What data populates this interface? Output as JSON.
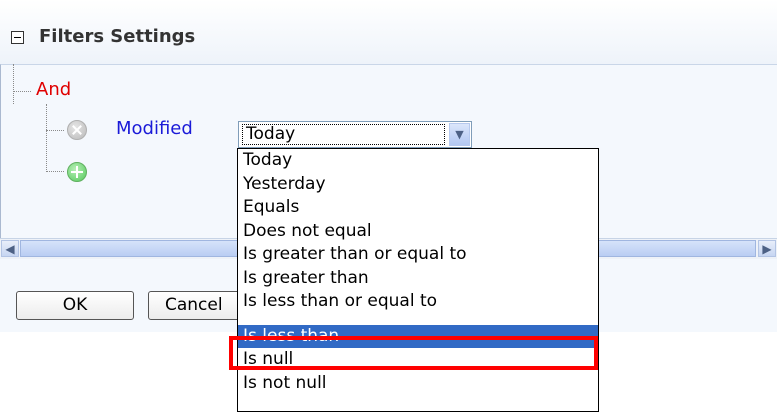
{
  "panel": {
    "title": "Filters Settings",
    "collapse_icon": "minus-square-icon"
  },
  "tree": {
    "group_label": "And",
    "field_label": "Modified",
    "remove_icon": "remove-circle-icon",
    "add_icon": "add-circle-icon"
  },
  "select": {
    "value": "Today",
    "options": [
      "Today",
      "Yesterday",
      "Equals",
      "Does not equal",
      "Is greater than or equal to",
      "Is greater than",
      "Is less than or equal to",
      "Is less than",
      "Is null",
      "Is not null"
    ],
    "highlighted_option": "Is less than"
  },
  "buttons": {
    "ok": "OK",
    "cancel": "Cancel"
  },
  "colors": {
    "group_label": "#e00000",
    "field_label": "#1a1ad8",
    "selection": "#316ac5",
    "callout": "#ff0000"
  }
}
